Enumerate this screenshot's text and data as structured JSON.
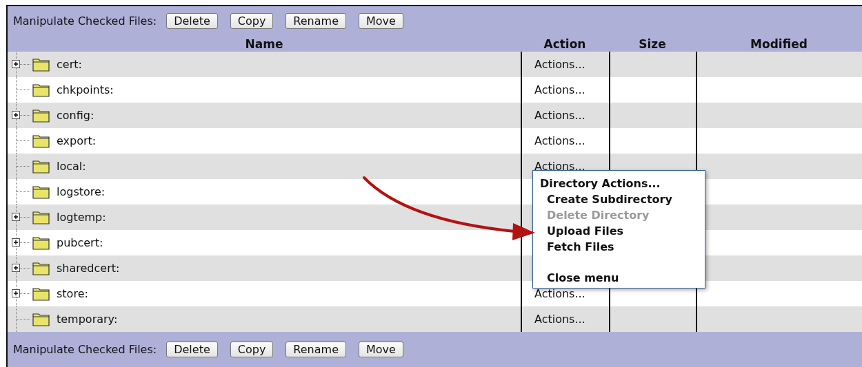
{
  "top_toolbar": {
    "label": "Manipulate Checked Files:",
    "buttons": [
      "Delete",
      "Copy",
      "Rename",
      "Move"
    ]
  },
  "table": {
    "columns": [
      "Name",
      "Action",
      "Size",
      "Modified"
    ],
    "rows": [
      {
        "name": "cert:",
        "has_children": true,
        "action": "Actions..."
      },
      {
        "name": "chkpoints:",
        "has_children": false,
        "action": "Actions..."
      },
      {
        "name": "config:",
        "has_children": true,
        "action": "Actions..."
      },
      {
        "name": "export:",
        "has_children": false,
        "action": "Actions..."
      },
      {
        "name": "local:",
        "has_children": false,
        "action": "Actions..."
      },
      {
        "name": "logstore:",
        "has_children": false
      },
      {
        "name": "logtemp:",
        "has_children": true
      },
      {
        "name": "pubcert:",
        "has_children": true
      },
      {
        "name": "sharedcert:",
        "has_children": true
      },
      {
        "name": "store:",
        "has_children": true,
        "action": "Actions..."
      },
      {
        "name": "temporary:",
        "has_children": false,
        "action": "Actions..."
      }
    ]
  },
  "context_menu": {
    "items": [
      {
        "kind": "heading",
        "label": "Directory Actions..."
      },
      {
        "kind": "item",
        "label": "Create Subdirectory",
        "disabled": false
      },
      {
        "kind": "item",
        "label": "Delete Directory",
        "disabled": true
      },
      {
        "kind": "item",
        "label": "Upload Files",
        "disabled": false
      },
      {
        "kind": "item",
        "label": "Fetch Files",
        "disabled": false
      },
      {
        "kind": "spacer"
      },
      {
        "kind": "item",
        "label": "Close menu",
        "disabled": false
      }
    ]
  },
  "bottom_toolbar": {
    "label": "Manipulate Checked Files:",
    "buttons": [
      "Delete",
      "Copy",
      "Rename",
      "Move"
    ]
  }
}
